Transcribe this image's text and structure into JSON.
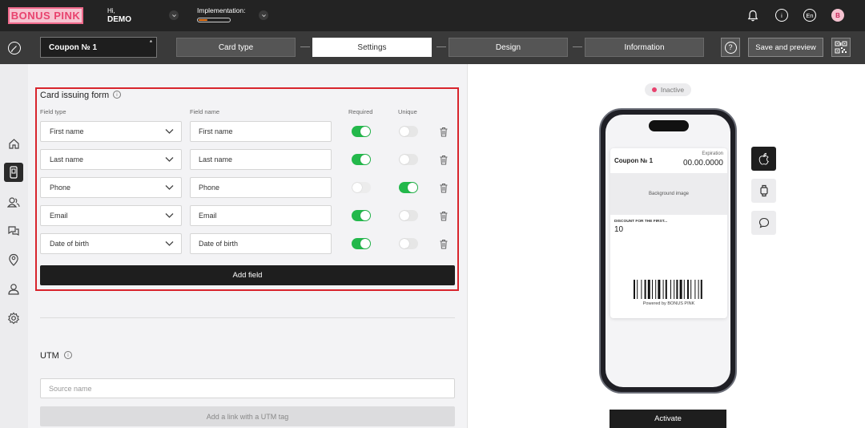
{
  "brand": {
    "logo_text": "BONUS PINK"
  },
  "user": {
    "greeting": "Hi,",
    "name": "DEMO"
  },
  "implementation": {
    "label": "Implementation:",
    "progress_fraction": 0.28
  },
  "top_icons": [
    "bell-icon",
    "info-icon",
    "language-icon",
    "avatar-icon"
  ],
  "top_labels": {
    "language": "En",
    "avatar": "B",
    "info": "i"
  },
  "toolbar": {
    "coupon_name": "Coupon № 1",
    "coupon_marker": "*",
    "steps": [
      "Card type",
      "Settings",
      "Design",
      "Information"
    ],
    "active_step": "Settings",
    "help_label": "?",
    "save_label": "Save and preview"
  },
  "sidebar": {
    "items": [
      "home-icon",
      "card-icon",
      "clients-icon",
      "messages-icon",
      "location-icon",
      "user-icon",
      "settings-icon"
    ],
    "active": "card-icon"
  },
  "form": {
    "title": "Card issuing form",
    "info_glyph": "i",
    "headers": {
      "field_type": "Field type",
      "field_name": "Field name",
      "required": "Required",
      "unique": "Unique"
    },
    "rows": [
      {
        "type": "First name",
        "name": "First name",
        "required": "on",
        "unique": "off"
      },
      {
        "type": "Last name",
        "name": "Last name",
        "required": "on",
        "unique": "off"
      },
      {
        "type": "Phone",
        "name": "Phone",
        "required": "disabled",
        "unique": "on"
      },
      {
        "type": "Email",
        "name": "Email",
        "required": "on",
        "unique": "off"
      },
      {
        "type": "Date of birth",
        "name": "Date of birth",
        "required": "on",
        "unique": "off"
      }
    ],
    "add_label": "Add field"
  },
  "utm": {
    "title": "UTM",
    "info_glyph": "i",
    "source_placeholder": "Source name",
    "add_link_label": "Add a link with a UTM tag"
  },
  "preview": {
    "status": "Inactive",
    "card": {
      "title": "Coupon № 1",
      "expiration_label": "Expiration",
      "expiration_value": "00.00.0000",
      "background_label": "Background image",
      "discount_label": "DISCOUNT FOR THE FIRST...",
      "discount_value": "10",
      "powered_by": "Powered by BONUS PINK"
    },
    "side_buttons": [
      "apple-icon",
      "android-icon",
      "message-icon"
    ],
    "activate_label": "Activate"
  },
  "colors": {
    "brand_pink": "#e8426e",
    "toggle_on": "#23b84b",
    "highlight_border": "#d8242c",
    "dark": "#232323"
  }
}
